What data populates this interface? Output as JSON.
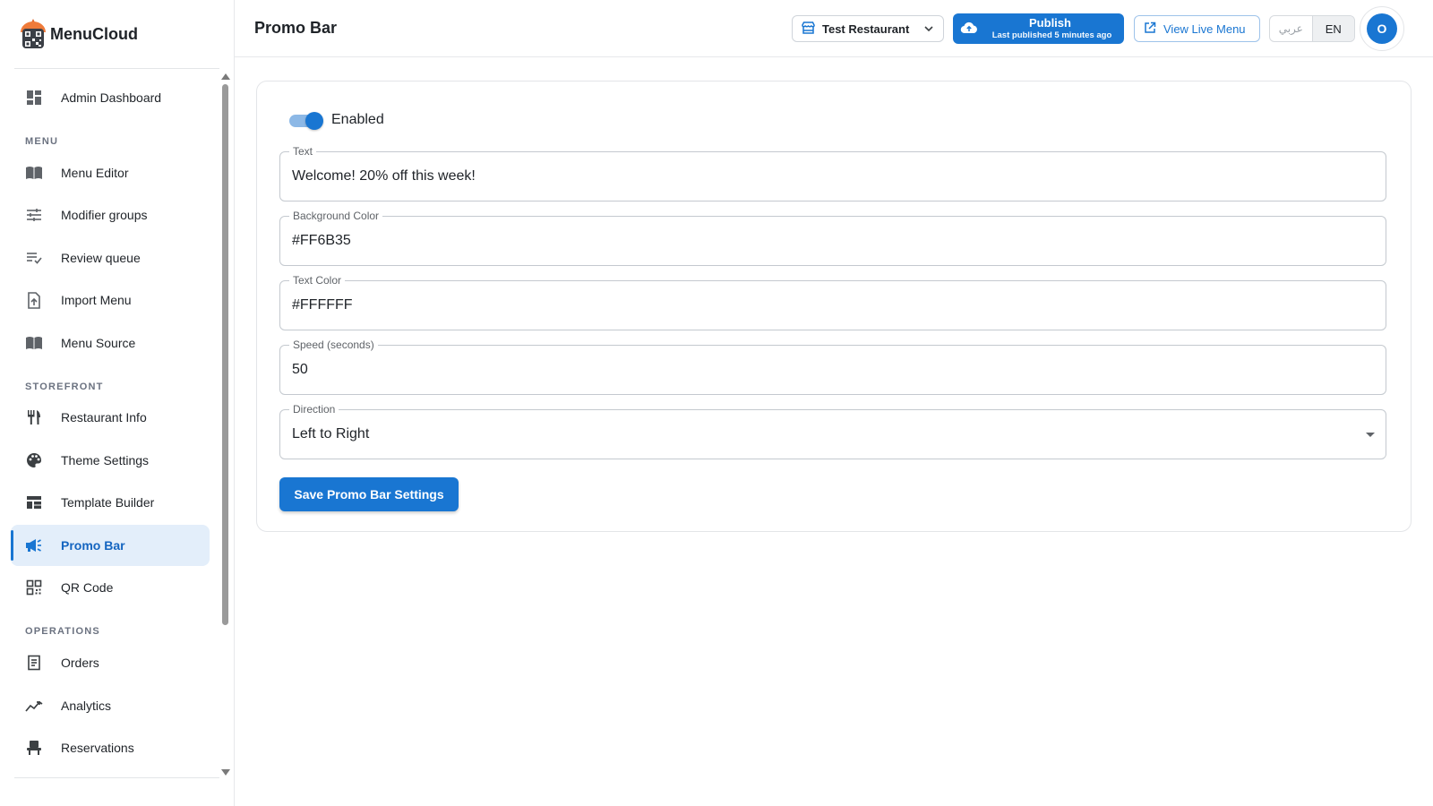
{
  "brand": {
    "name": "MenuCloud",
    "logo_icon": "menucloud-logo-icon"
  },
  "sidebar": {
    "items": [
      {
        "label": "Admin Dashboard",
        "icon": "dashboard-icon"
      },
      {
        "label": "Menu Editor",
        "icon": "book-icon"
      },
      {
        "label": "Modifier groups",
        "icon": "tune-icon"
      },
      {
        "label": "Review queue",
        "icon": "playlist-check-icon"
      },
      {
        "label": "Import Menu",
        "icon": "file-upload-icon"
      },
      {
        "label": "Menu Source",
        "icon": "book-icon"
      },
      {
        "label": "Restaurant Info",
        "icon": "fork-knife-icon"
      },
      {
        "label": "Theme Settings",
        "icon": "palette-icon"
      },
      {
        "label": "Template Builder",
        "icon": "template-icon"
      },
      {
        "label": "Promo Bar",
        "icon": "megaphone-icon"
      },
      {
        "label": "QR Code",
        "icon": "qr-code-icon"
      },
      {
        "label": "Orders",
        "icon": "receipt-icon"
      },
      {
        "label": "Analytics",
        "icon": "trending-icon"
      },
      {
        "label": "Reservations",
        "icon": "chair-icon"
      }
    ],
    "sections": {
      "menu": "MENU",
      "storefront": "STOREFRONT",
      "operations": "OPERATIONS"
    },
    "active_item": "Promo Bar"
  },
  "header": {
    "title": "Promo Bar",
    "restaurant": "Test Restaurant",
    "publish_label": "Publish",
    "publish_sub": "Last published 5 minutes ago",
    "view_live": "View Live Menu",
    "lang_ar": "عربي",
    "lang_en": "EN",
    "avatar_initial": "O"
  },
  "form": {
    "enabled_label": "Enabled",
    "enabled": true,
    "fields": {
      "text": {
        "label": "Text",
        "value": "Welcome! 20% off this week!"
      },
      "bg_color": {
        "label": "Background Color",
        "value": "#FF6B35"
      },
      "text_color": {
        "label": "Text Color",
        "value": "#FFFFFF"
      },
      "speed": {
        "label": "Speed (seconds)",
        "value": "50"
      },
      "direction": {
        "label": "Direction",
        "value": "Left to Right"
      }
    },
    "save_label": "Save Promo Bar Settings"
  },
  "colors": {
    "primary": "#1976d2",
    "active_bg": "#e3eefa",
    "border": "#c4c9cf"
  }
}
